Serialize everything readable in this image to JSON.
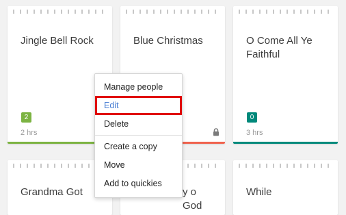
{
  "cards": [
    {
      "title": "Jingle Bell Rock",
      "badge": "2",
      "time": "2 hrs",
      "badge_color": "#7cb342",
      "bar_color": "#7cb342"
    },
    {
      "title": "Blue Christmas",
      "bar_color": "#f0624d"
    },
    {
      "title": "O Come All Ye Faithful",
      "badge": "0",
      "time": "3 hrs",
      "badge_color": "#00897b",
      "bar_color": "#00897b"
    },
    {
      "title": "Grandma Got"
    },
    {
      "title": "y o God"
    },
    {
      "title": "While"
    }
  ],
  "context_menu": {
    "items": [
      "Manage people",
      "Edit",
      "Delete",
      "Create a copy",
      "Move",
      "Add to quickies"
    ],
    "highlighted": "Edit",
    "highlight_color": "#e00000",
    "highlight_text_color": "#4a7fd4"
  },
  "icons": {
    "lock": "lock-icon"
  }
}
